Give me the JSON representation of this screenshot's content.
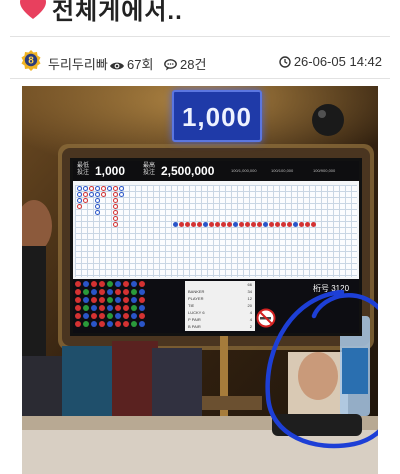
{
  "post": {
    "title": "전체게에서..",
    "accent_color": "#e8405e"
  },
  "meta": {
    "level": "8",
    "author": "두리두리빠",
    "views": "67회",
    "comments": "28건",
    "date": "26-06-05 14:42",
    "icons": [
      "eye-icon",
      "comment-icon",
      "clock-icon",
      "level-badge-icon"
    ]
  },
  "photo": {
    "bet_sign": "1,000",
    "table_label": "桁号 3120",
    "limits": {
      "min_label": "最低\n投注",
      "min_value": "1,000",
      "max_label": "最高\n投注",
      "max_value": "2,500,000",
      "sub1": "100/1,000,000",
      "sub2": "100/100,000",
      "sub3": "100/900,000"
    },
    "stats": [
      {
        "name": "BANKER",
        "value": "34"
      },
      {
        "name": "PLAYER",
        "value": "12"
      },
      {
        "name": "TIE",
        "value": "20"
      },
      {
        "name": "LUCKY 6",
        "value": "4"
      },
      {
        "name": "P PAIR",
        "value": "4"
      },
      {
        "name": "B PAIR",
        "value": "2"
      }
    ],
    "stats_total": "66",
    "highlight_color": "#1d3fd6"
  }
}
